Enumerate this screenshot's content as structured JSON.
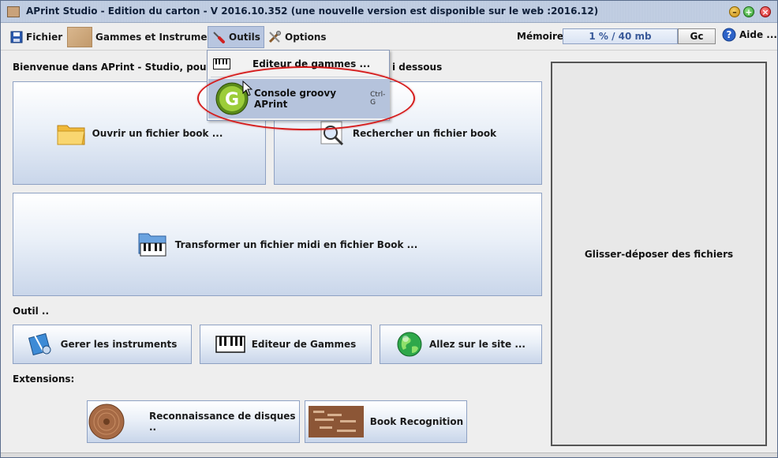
{
  "window": {
    "title": "APrint Studio - Edition du carton  - V 2016.10.352 (une nouvelle version est disponible sur le web :2016.12)"
  },
  "menubar": {
    "fichier": "Fichier",
    "gammes": "Gammes et Instruments",
    "outils": "Outils",
    "options": "Options",
    "memory_label": "Mémoire :",
    "memory_value": "1 % / 40 mb",
    "gc": "Gc",
    "help": "Aide ..."
  },
  "dropdown": {
    "items": [
      {
        "label": "Editeur de gammes ...",
        "shortcut": ""
      },
      {
        "label": "Console groovy APrint",
        "shortcut": "Ctrl-G"
      }
    ]
  },
  "main": {
    "welcome": "Bienvenue dans APrint - Studio, pour démar",
    "welcome_tail": "i dessous",
    "open_book": "Ouvrir un fichier book ...",
    "search_book": "Rechercher un fichier book",
    "midi_to_book": "Transformer un fichier midi en fichier Book ...",
    "tools_section": "Outil ..",
    "manage_instruments": "Gerer les instruments",
    "scale_editor": "Editeur de Gammes",
    "website": "Allez sur le site ...",
    "extensions_section": "Extensions:",
    "disc_recognition": "Reconnaissance de disques ..",
    "book_recognition": "Book Recognition"
  },
  "dropzone": {
    "label": "Glisser-déposer des fichiers"
  },
  "colors": {
    "menu_highlight": "#b5c3dc",
    "annotation": "#d51a1a",
    "button_border": "#8ea1c3"
  }
}
